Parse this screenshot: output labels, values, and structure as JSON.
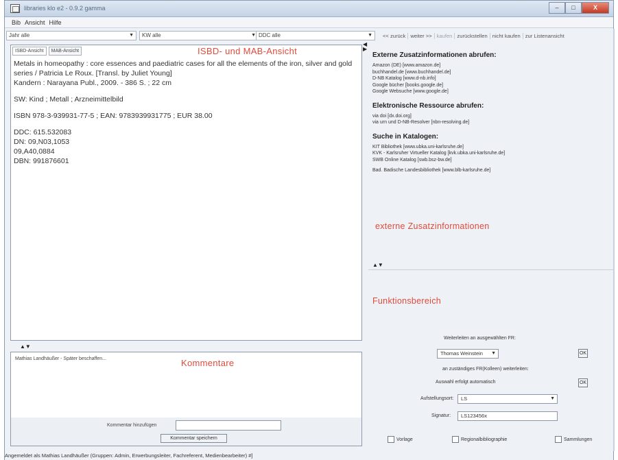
{
  "window": {
    "title": "libraries klo e2 - 0.9.2 gamma",
    "min": "–",
    "max": "□",
    "close": "X"
  },
  "menu": [
    "Bib",
    "Ansicht",
    "Hilfe"
  ],
  "filters": [
    {
      "label": "Jahr alle"
    },
    {
      "label": "KW alle"
    },
    {
      "label": "DDC alle"
    }
  ],
  "nav": [
    "<< zurück",
    "weiter >>",
    "kaufen",
    "zurückstellen",
    "nicht kaufen",
    "zur Listenansicht"
  ],
  "left": {
    "tabs": [
      "ISBD-Ansicht",
      "MAB-Ansicht"
    ],
    "heading": "ISBD- und MAB-Ansicht",
    "record": [
      "Metals in homeopathy : core essences and paediatric cases for all the elements of the iron, silver and gold series / Patricia Le Roux. [Transl. by Juliet Young]",
      "Kandern : Narayana Publ., 2009. - 386 S. ; 22 cm",
      "SW: Kind ; Metall ; Arzneimittelbild",
      "ISBN 978-3-939931-77-5 ; EAN: 9783939931775 ; EUR 38.00",
      "DDC: 615.532083",
      "DN: 09,N03,1053",
      "09,A40,0884",
      "DBN: 991876601"
    ]
  },
  "comments": {
    "heading": "Kommentare",
    "entry": "Mathias Landhäußer - Später beschaffen...",
    "add_label": "Kommentar hinzufügen",
    "input_value": "",
    "save_button": "Kommentar speichern"
  },
  "external": {
    "title1": "Externe Zusatzinformationen abrufen:",
    "links1": [
      "Amazon (DE) [www.amazon.de]",
      "buchhandel.de [www.buchhandel.de]",
      "D-NB Katalog [www.d-nb.info]",
      "Google bücher [books.google.de]",
      "Google Websuche [www.google.de]"
    ],
    "title2": "Elektronische Ressource abrufen:",
    "links2": [
      "via doi [dx.doi.org]",
      "via urn und D-NB-Resolver [nbn-resolving.de]"
    ],
    "title3": "Suche in Katalogen:",
    "links3": [
      "KIT Bibliothek [www.ubka.uni-karlsruhe.de]",
      "KVK - Karlsruher Virtueller Katalog [kvk.ubka.uni-karlsruhe.de]",
      "SWB Online Katalog [swb.bsz-bw.de]"
    ],
    "links3b": "Bad. Badische Landesbibliothek [www.blb-karlsruhe.de]",
    "red_label": "externe Zusatzinformationen"
  },
  "func": {
    "heading": "Funktionsbereich",
    "forward_label": "Weiterleiten an ausgewählten FR:",
    "person_select": "Thomas Weinstein",
    "responsible_label": "an zuständiges FR(Kolleen) weiterleiten:",
    "auto_label": "Auswahl erfolgt automatisch",
    "ok1": "OK",
    "ok2": "OK",
    "location_label": "Aufstellungsort:",
    "location_value": "LS",
    "signature_label": "Signatur:",
    "signature_value": "LS123456x",
    "checkboxes": [
      "Vorlage",
      "Regionalbibliographie",
      "Sammlungen"
    ]
  },
  "status": "Angemeldet als Mathias Landhäußer (Gruppen: Admin, Erwerbungsleiter, Fachreferent, Medienbearbeiter) #]"
}
